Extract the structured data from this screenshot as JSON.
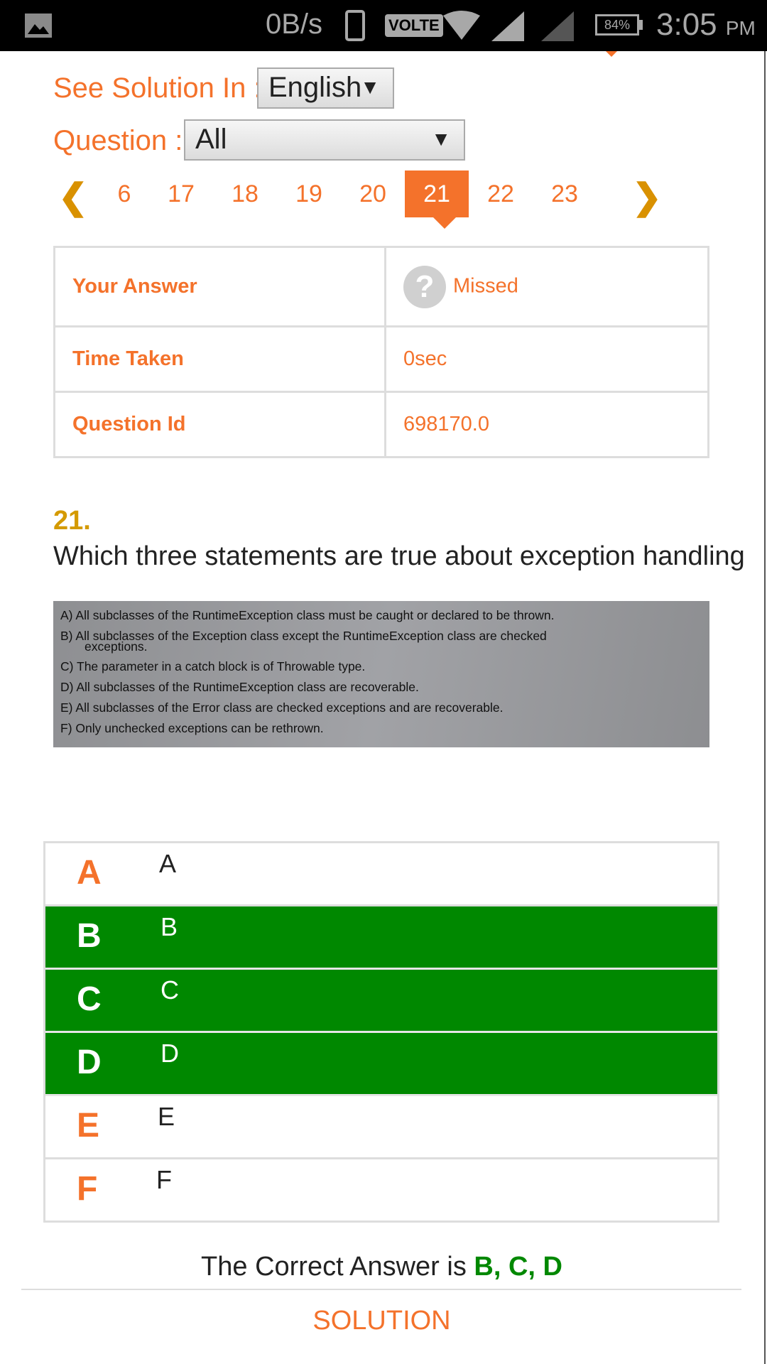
{
  "status_bar": {
    "net_speed": "0B/s",
    "volte": "VOLTE",
    "battery": "84%",
    "time": "3:05",
    "ampm": "PM"
  },
  "solution_lang": {
    "label": "See Solution In :",
    "value": "English"
  },
  "question_filter": {
    "label": "Question :",
    "value": "All"
  },
  "pager": {
    "pages": [
      "6",
      "17",
      "18",
      "19",
      "20",
      "21",
      "22",
      "23"
    ],
    "active": "21"
  },
  "info_table": [
    {
      "key": "Your Answer",
      "value": "Missed"
    },
    {
      "key": "Time Taken",
      "value": "0sec"
    },
    {
      "key": "Question Id",
      "value": "698170.0"
    }
  ],
  "question": {
    "number": "21.",
    "text": "Which three statements are true about exception handling",
    "image_lines": [
      "A) All subclasses of the RuntimeException class must be caught or declared to be thrown.",
      "B) All subclasses of the Exception class except the RuntimeException class are checked",
      "exceptions.",
      "C) The parameter in a catch block is of Throwable type.",
      "D) All subclasses of the RuntimeException class are recoverable.",
      "E) All subclasses of the Error class are checked exceptions and are recoverable.",
      "F) Only unchecked exceptions can be rethrown."
    ]
  },
  "options": [
    {
      "letter": "A",
      "text": "A",
      "correct": false
    },
    {
      "letter": "B",
      "text": "B",
      "correct": true
    },
    {
      "letter": "C",
      "text": "C",
      "correct": true
    },
    {
      "letter": "D",
      "text": "D",
      "correct": true
    },
    {
      "letter": "E",
      "text": "E",
      "correct": false
    },
    {
      "letter": "F",
      "text": "F",
      "correct": false
    }
  ],
  "answer": {
    "prefix": "The Correct Answer is",
    "value": "B, C, D"
  },
  "solution_label": "SOLUTION",
  "colors": {
    "accent": "#f4722b",
    "correct": "#008800",
    "number": "#d49a00"
  }
}
